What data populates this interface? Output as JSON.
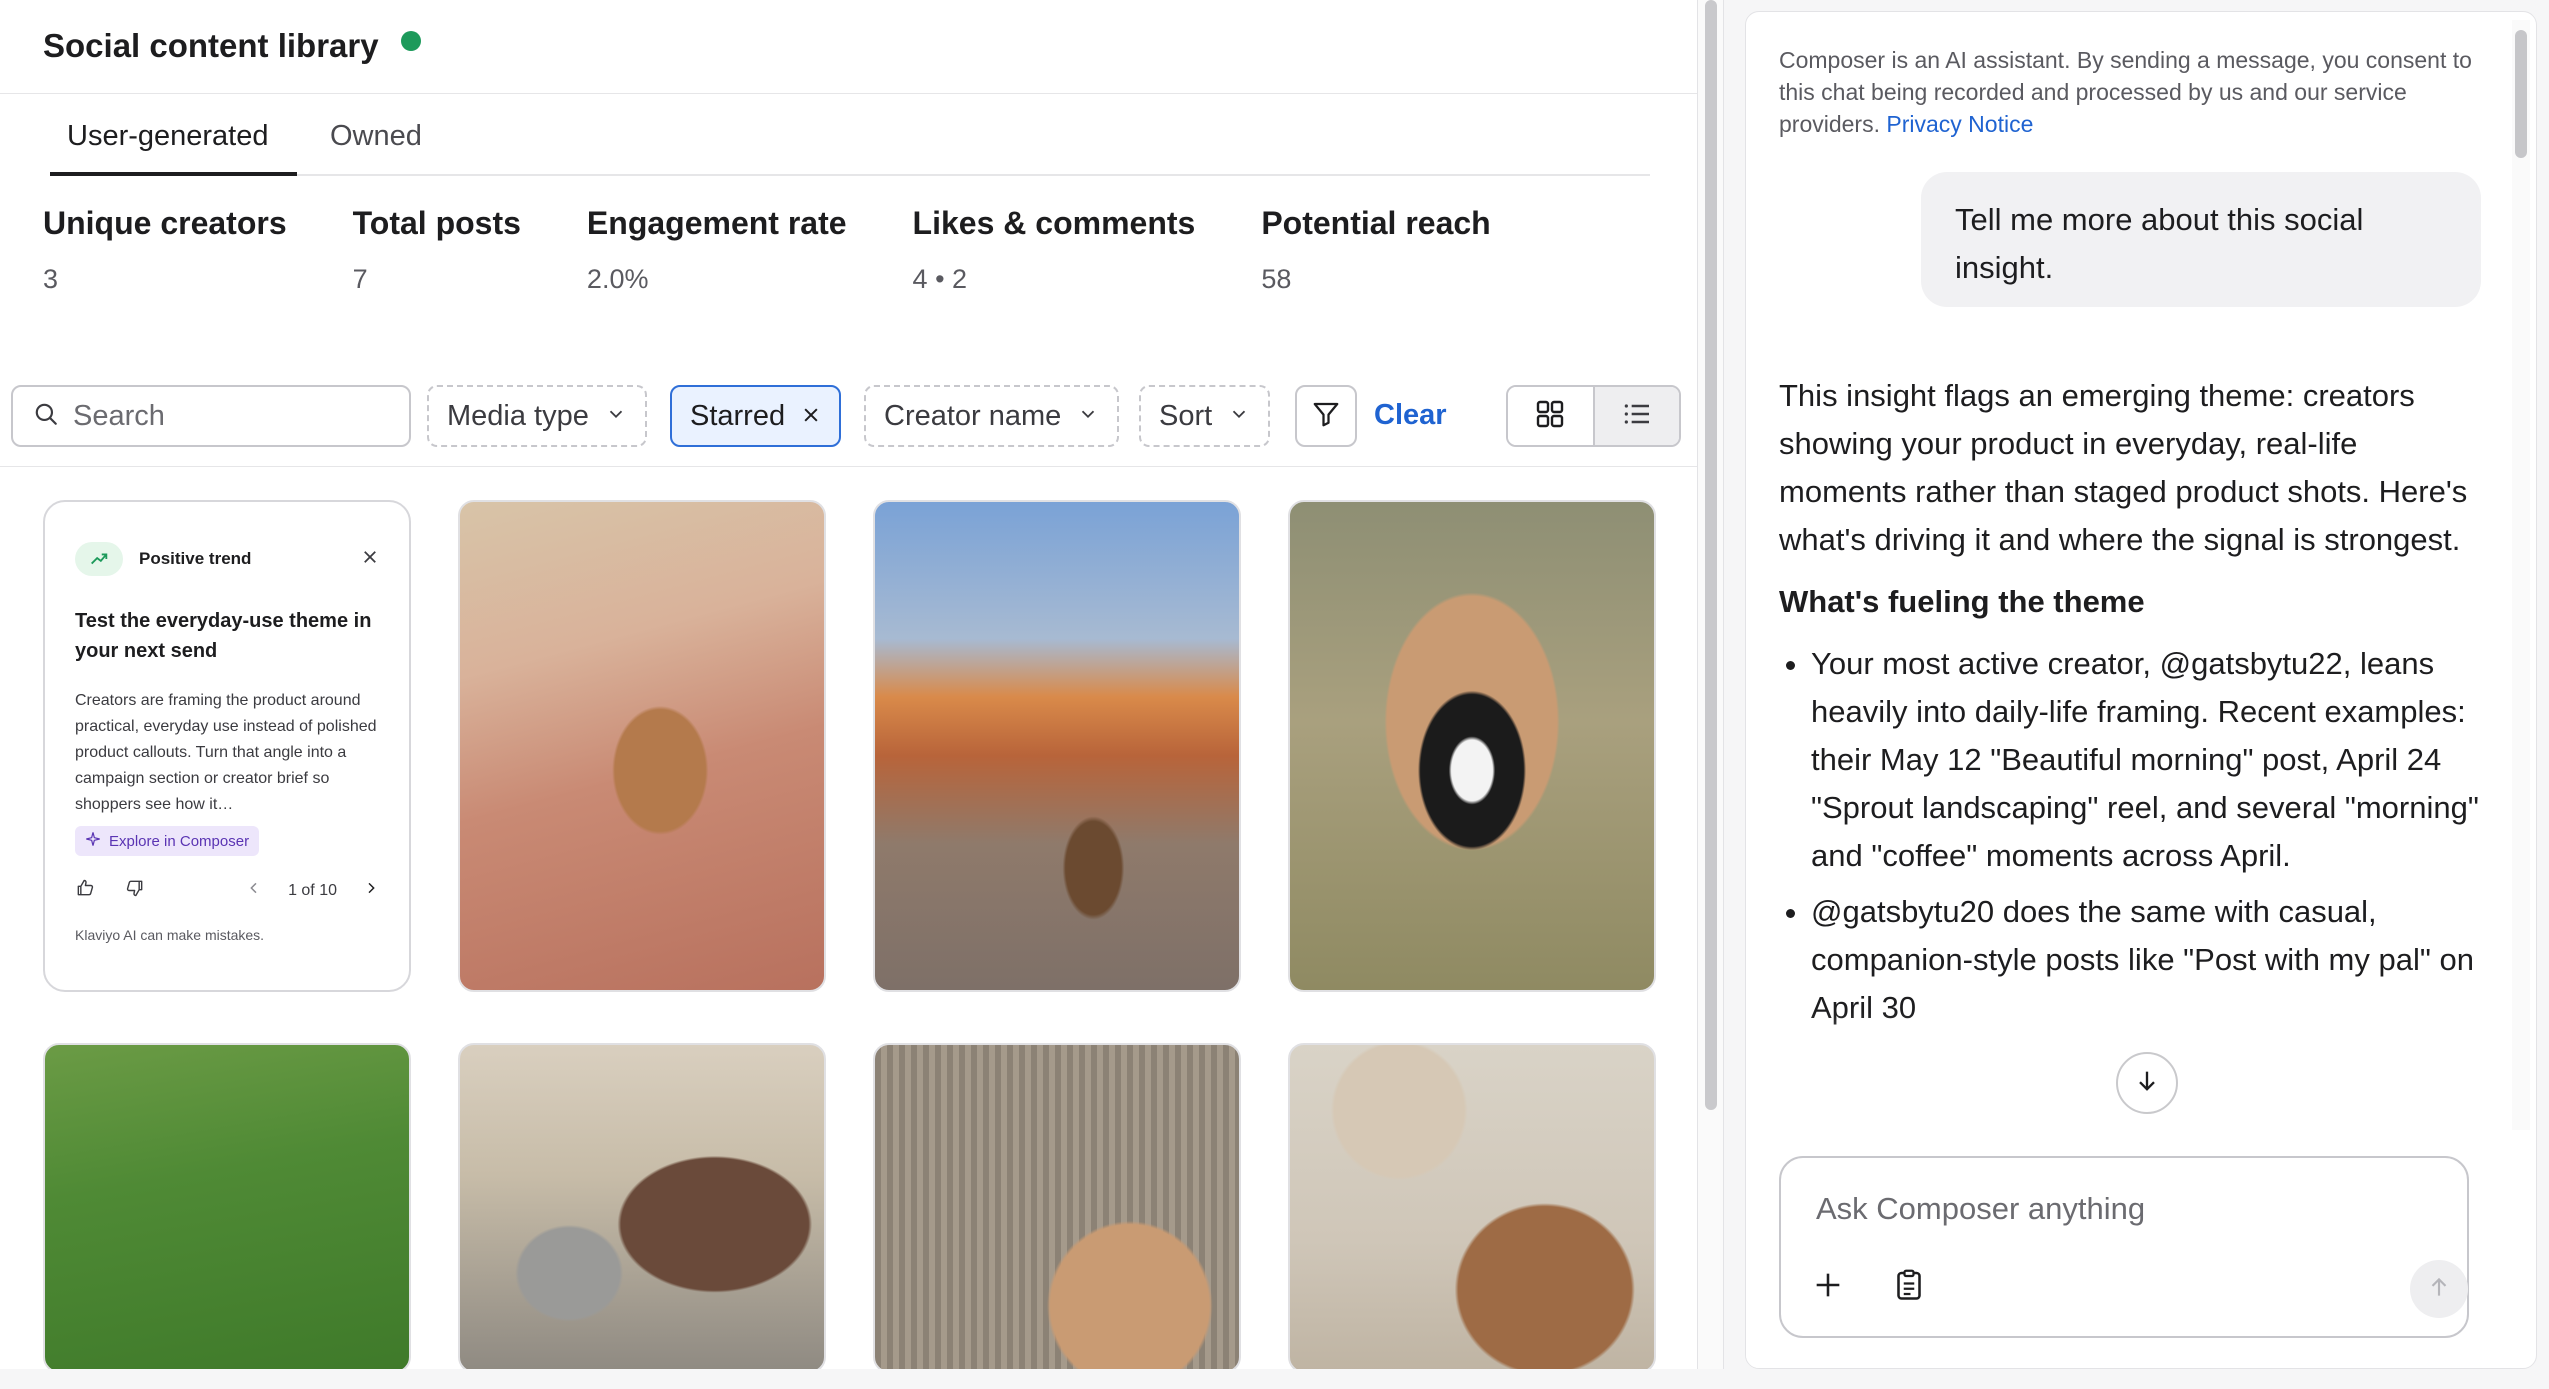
{
  "header": {
    "title": "Social content library"
  },
  "tabs": [
    {
      "label": "User-generated"
    },
    {
      "label": "Owned"
    }
  ],
  "stats": [
    {
      "label": "Unique creators",
      "value": "3"
    },
    {
      "label": "Total posts",
      "value": "7"
    },
    {
      "label": "Engagement rate",
      "value": "2.0%"
    },
    {
      "label": "Likes & comments",
      "value": "4 • 2"
    },
    {
      "label": "Potential reach",
      "value": "58"
    }
  ],
  "filters": {
    "search_placeholder": "Search",
    "media_type": "Media type",
    "starred": "Starred",
    "creator_name": "Creator name",
    "sort": "Sort",
    "clear": "Clear"
  },
  "insight": {
    "badge": "Positive trend",
    "title": "Test the everyday-use theme in your next send",
    "body": "Creators are framing the product around practical, everyday use instead of polished product callouts. Turn that angle into a campaign section or creator brief so shoppers see how it…",
    "explore": "Explore in Composer",
    "pager": "1 of 10",
    "disclaimer": "Klaviyo AI can make mistakes."
  },
  "composer_panel": {
    "consent_text": "Composer is an AI assistant. By sending a message, you consent to this chat being recorded and processed by us and our service providers.",
    "privacy_link": "Privacy Notice",
    "user_message": "Tell me more about this social insight.",
    "answer_intro": "This insight flags an emerging theme: creators showing your product in everyday, real-life moments rather than staged product shots. Here's what's driving it and where the signal is strongest.",
    "answer_heading": "What's fueling the theme",
    "answer_bullets": [
      "Your most active creator, @gatsbytu22, leans heavily into daily-life framing. Recent examples: their May 12 \"Beautiful morning\" post, April 24 \"Sprout landscaping\" reel, and several \"morning\" and \"coffee\" moments across April.",
      "@gatsbytu20 does the same with casual, companion-style posts like \"Post with my pal\" on April 30"
    ],
    "input_placeholder": "Ask Composer anything"
  },
  "colors": {
    "accent": "#1f63d1",
    "status_dot": "#1d9a5b",
    "starred_bg": "#eaf2ff",
    "explore_bg": "#ede6fb"
  },
  "icons": [
    "search-icon",
    "chevron-down-icon",
    "close-icon",
    "filter-icon",
    "grid-view-icon",
    "list-view-icon",
    "trend-up-icon",
    "thumbs-up-icon",
    "thumbs-down-icon",
    "chevron-left-icon",
    "chevron-right-icon",
    "sparkle-icon",
    "arrow-down-icon",
    "plus-icon",
    "clipboard-icon",
    "arrow-up-icon"
  ]
}
